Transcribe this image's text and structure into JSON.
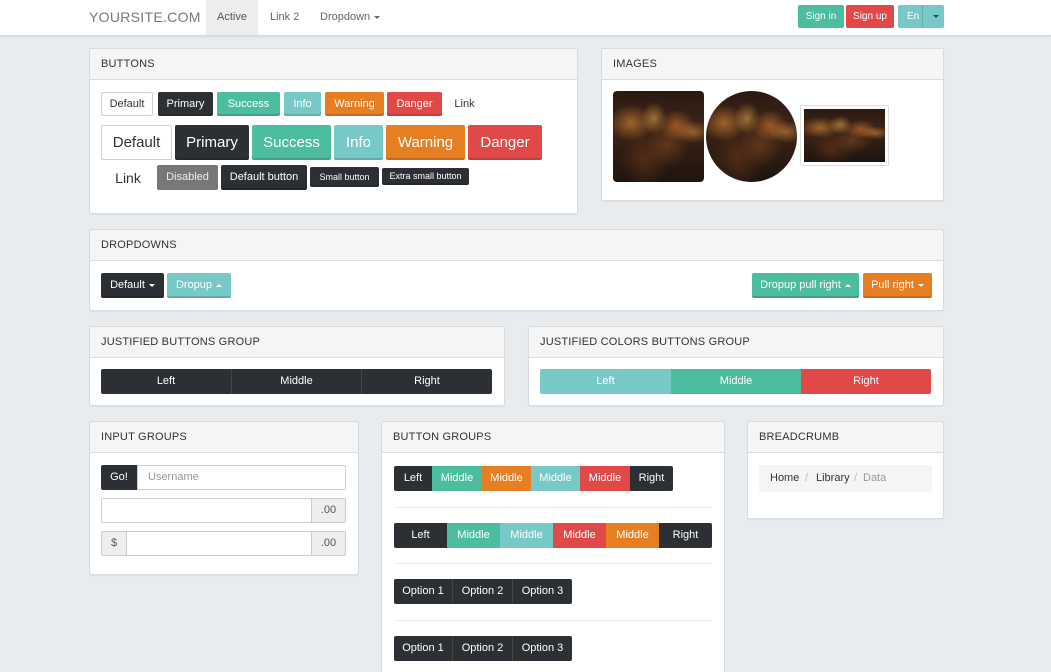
{
  "navbar": {
    "brand": "YOURSITE.COM",
    "items": [
      "Active",
      "Link 2",
      "Dropdown"
    ],
    "sign_in": "Sign in",
    "sign_up": "Sign up",
    "lang": "En"
  },
  "buttons_panel": {
    "title": "BUTTONS",
    "row1": [
      "Default",
      "Primary",
      "Success",
      "Info",
      "Warning",
      "Danger",
      "Link"
    ],
    "row2": [
      "Default",
      "Primary",
      "Success",
      "Info",
      "Warning",
      "Danger"
    ],
    "row3": [
      "Link",
      "Disabled",
      "Default button",
      "Small button",
      "Extra small button"
    ]
  },
  "images_panel": {
    "title": "IMAGES"
  },
  "dropdowns_panel": {
    "title": "DROPDOWNS",
    "default": "Default",
    "dropup": "Dropup",
    "dropup_right": "Dropup pull right",
    "pull_right": "Pull right"
  },
  "justified_panel": {
    "title": "JUSTIFIED BUTTONS GROUP",
    "items": [
      "Left",
      "Middle",
      "Right"
    ]
  },
  "justified_colors_panel": {
    "title": "JUSTIFIED COLORS BUTTONS GROUP",
    "items": [
      "Left",
      "Middle",
      "Right"
    ]
  },
  "input_groups_panel": {
    "title": "INPUT GROUPS",
    "go": "Go!",
    "username_placeholder": "Username",
    "suffix": ".00",
    "prefix": "$"
  },
  "button_groups_panel": {
    "title": "BUTTON GROUPS",
    "group1": [
      "Left",
      "Middle",
      "Middle",
      "Middle",
      "Middle",
      "Right"
    ],
    "group2": [
      "Left",
      "Middle",
      "Middle",
      "Middle",
      "Middle",
      "Right"
    ],
    "group3": [
      "Option 1",
      "Option 2",
      "Option 3"
    ],
    "group4": [
      "Option 1",
      "Option 2",
      "Option 3"
    ]
  },
  "breadcrumb_panel": {
    "title": "BREADCRUMB",
    "items": [
      "Home",
      "Library",
      "Data"
    ]
  }
}
